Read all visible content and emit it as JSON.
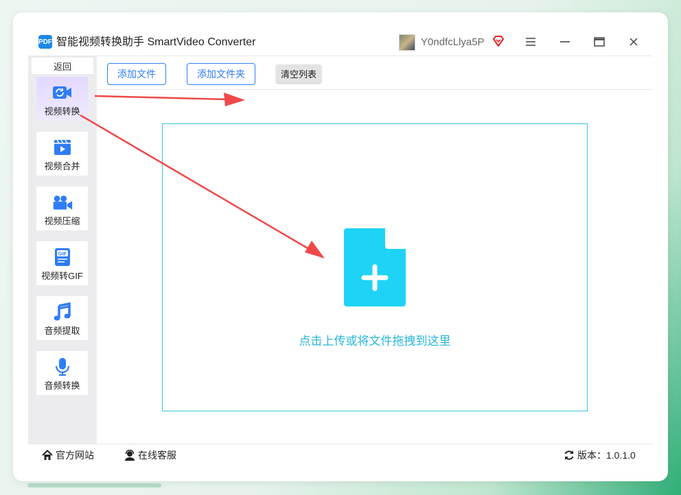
{
  "window": {
    "app_title": "智能视频转换助手 SmartVideo Converter",
    "logo_text": "PDF",
    "username": "Y0ndfcLlya5P"
  },
  "sidebar": {
    "back_label": "返回",
    "items": [
      {
        "label": "视频转换",
        "icon": "video-convert-icon",
        "active": true
      },
      {
        "label": "视频合并",
        "icon": "video-merge-icon"
      },
      {
        "label": "视频压缩",
        "icon": "video-compress-icon"
      },
      {
        "label": "视频转GIF",
        "icon": "gif-icon"
      },
      {
        "label": "音频提取",
        "icon": "music-note-icon"
      },
      {
        "label": "音频转换",
        "icon": "microphone-icon"
      }
    ]
  },
  "toolbar": {
    "add_file": "添加文件",
    "add_folder": "添加文件夹",
    "clear_list": "清空列表"
  },
  "dropzone": {
    "hint": "点击上传或将文件拖拽到这里"
  },
  "footer": {
    "website": "官方网站",
    "support": "在线客服",
    "version_label": "版本：",
    "version": "1.0.1.0"
  },
  "colors": {
    "accent_blue": "#2f7cf6",
    "cyan": "#1ed3f5",
    "annotation_red": "#f04848"
  }
}
